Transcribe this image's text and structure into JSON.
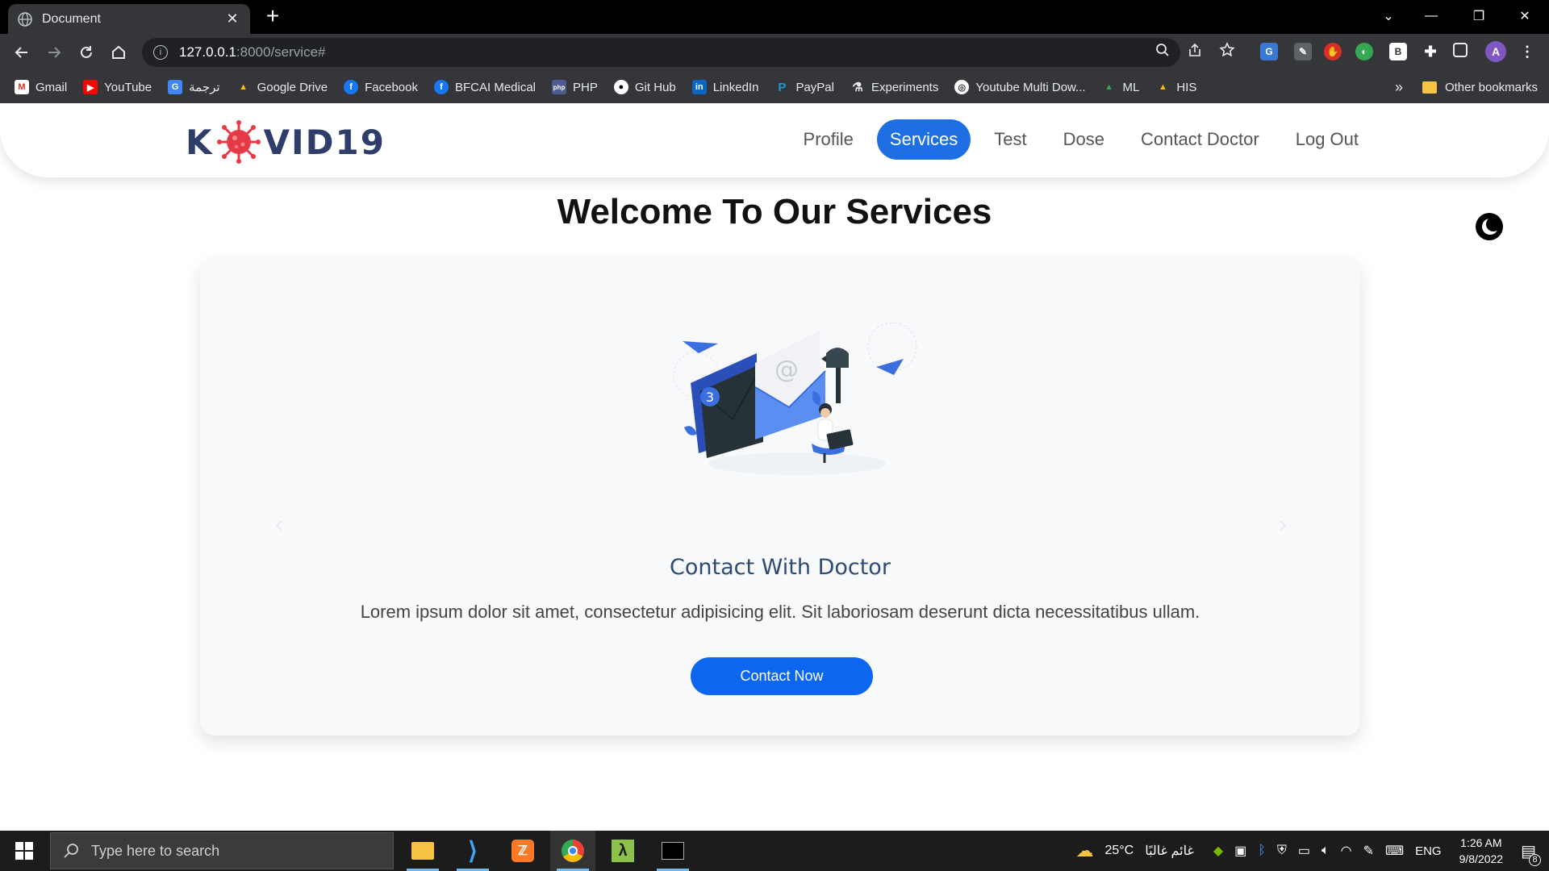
{
  "browser": {
    "tab_title": "Document",
    "url_host": "127.0.0.1",
    "url_path": ":8000/service#",
    "bookmarks": [
      "Gmail",
      "YouTube",
      "ترجمة",
      "Google Drive",
      "Facebook",
      "BFCAI Medical",
      "PHP",
      "Git Hub",
      "LinkedIn",
      "PayPal",
      "Experiments",
      "Youtube Multi Dow...",
      "ML",
      "HIS"
    ],
    "more_bookmarks": "»",
    "other_bookmarks": "Other bookmarks",
    "profile_initial": "A"
  },
  "site": {
    "logo_left": "K",
    "logo_right": "VID19",
    "nav": [
      "Profile",
      "Services",
      "Test",
      "Dose",
      "Contact Doctor",
      "Log Out"
    ],
    "active_nav": "Services",
    "welcome": "Welcome To Our Services",
    "card": {
      "badge_count": "3",
      "title": "Contact With Doctor",
      "text": "Lorem ipsum dolor sit amet, consectetur adipisicing elit. Sit laboriosam deserunt dicta necessitatibus ullam.",
      "button": "Contact Now"
    }
  },
  "taskbar": {
    "search_placeholder": "Type here to search",
    "weather_temp": "25°C",
    "weather_text": "غائم غالبًا",
    "language": "ENG",
    "time": "1:26 AM",
    "date": "9/8/2022",
    "notification_count": "8"
  },
  "colors": {
    "accent": "#1d6fe3",
    "button": "#0d66ef",
    "logo": "#2f3d6b",
    "virus": "#e63946",
    "card_title": "#2f4a73"
  }
}
